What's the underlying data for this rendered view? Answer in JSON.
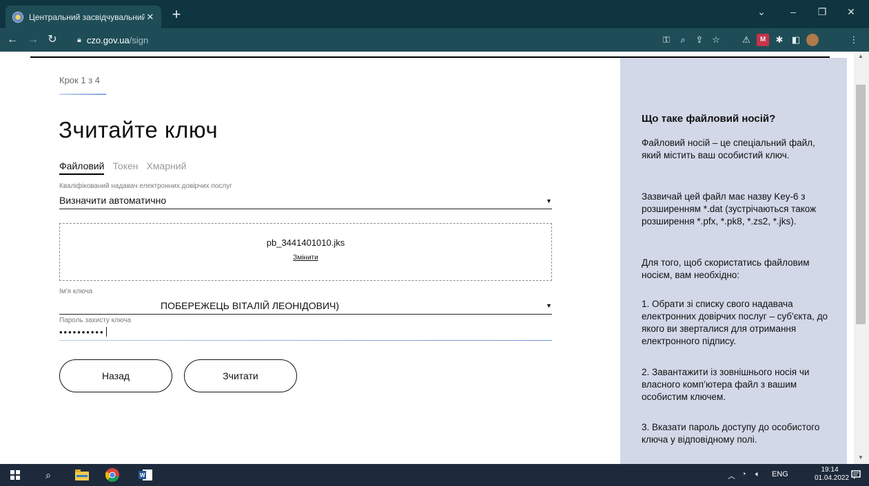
{
  "browser": {
    "tab_title": "Центральний засвідчувальний",
    "url_host": "czo.gov.ua",
    "url_path": "/sign"
  },
  "main": {
    "step_text": "Крок 1 з 4",
    "heading": "Зчитайте ключ",
    "tabs": [
      {
        "label": "Файловий",
        "active": true
      },
      {
        "label": "Токен",
        "active": false
      },
      {
        "label": "Хмарний",
        "active": false
      }
    ],
    "provider": {
      "label": "Кваліфікований надавач електронних довірчих послуг",
      "value": "Визначити автоматично"
    },
    "file": {
      "name": "pb_3441401010.jks",
      "change_label": "Змінити"
    },
    "key_name": {
      "label": "Ім'я ключа",
      "value": "ПОБЕРЕЖЕЦЬ ВІТАЛІЙ ЛЕОНІДОВИЧ)"
    },
    "password": {
      "label": "Пароль захисту ключа",
      "value": "••••••••••"
    },
    "buttons": {
      "back": "Назад",
      "read": "Зчитати"
    }
  },
  "sidebar": {
    "title": "Що таке файловий носій?",
    "paragraphs": [
      "Файловий носій – це спеціальний файл, який містить ваш особистий ключ.",
      "Зазвичай цей файл має назву Key-6 з розширенням *.dat (зустрічаються також розширення *.pfx, *.pk8, *.zs2, *.jks).",
      "Для того, щоб скористатись файловим носієм, вам необхідно:",
      "1. Обрати зі списку свого надавача електронних довірчих послуг – суб'єкта, до якого ви зверталися для отримання електронного підпису.",
      "2. Завантажити із зовнішнього носія чи власного комп’ютера файл з вашим особистим ключем.",
      "3. Вказати пароль доступу до особистого ключа у відповідному полі."
    ]
  },
  "taskbar": {
    "lang": "ENG",
    "time": "19:14",
    "date": "01.04.2022"
  }
}
